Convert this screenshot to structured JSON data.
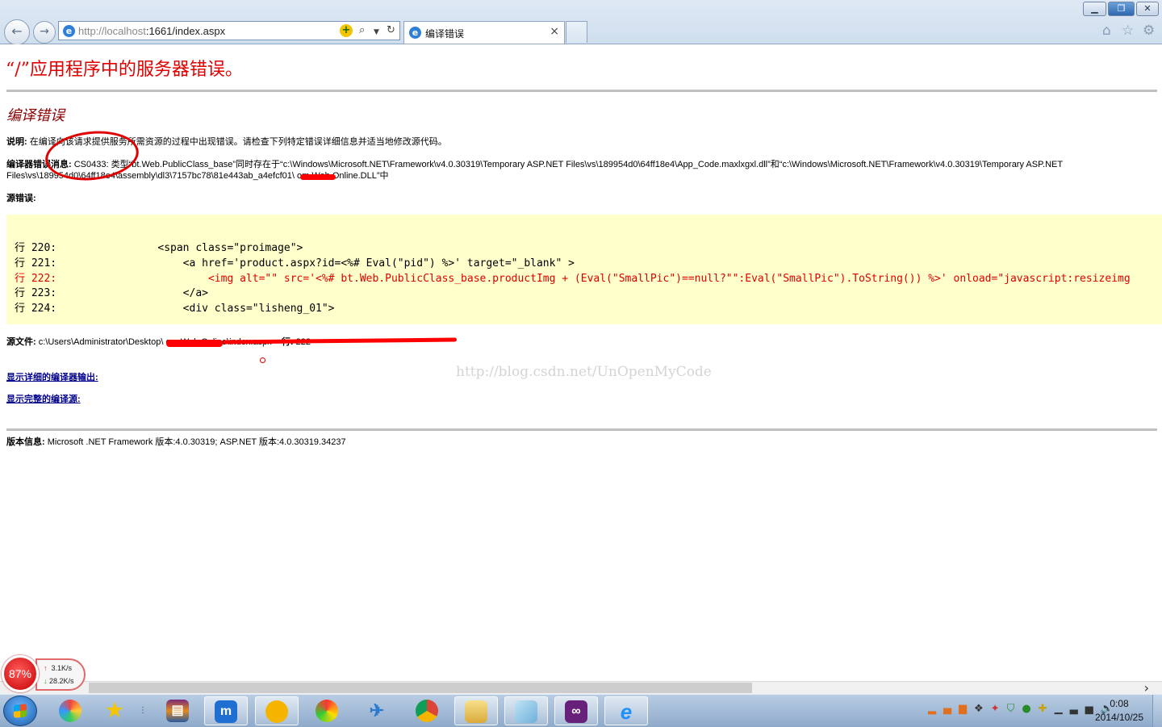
{
  "browser": {
    "address_url_host": "http://localhost",
    "address_url_path": ":1661/index.aspx",
    "tab_title": "编译错误",
    "back_icon": "back-arrow-icon",
    "forward_icon": "forward-arrow-icon"
  },
  "page": {
    "error_title": "“/”应用程序中的服务器错误。",
    "subtitle": "编译错误",
    "description_label": "说明:",
    "description_text": " 在编译向该请求提供服务所需资源的过程中出现错误。请检查下列特定错误详细信息并适当地修改源代码。",
    "compiler_label": "编译器错误消息:",
    "compiler_text": " CS0433: 类型“bt.Web.PublicClass_base”同时存在于“c:\\Windows\\Microsoft.NET\\Framework\\v4.0.30319\\Temporary ASP.NET Files\\vs\\189954d0\\64ff18e4\\App_Code.maxlxgxl.dll”和“c:\\Windows\\Microsoft.NET\\Framework\\v4.0.30319\\Temporary ASP.NET Files\\vs\\189954d0\\64ff18e4\\assembly\\dl3\\7157bc78\\81e443ab_a4efcf01\\         om.Web.Online.DLL”中",
    "source_error_label": "源错误:",
    "code_lines": [
      {
        "prefix": "行 220:",
        "code": "                <span class=\"proimage\">"
      },
      {
        "prefix": "行 221:",
        "code": "                    <a href='product.aspx?id=<%# Eval(\"pid\") %>' target=\"_blank\" >"
      },
      {
        "prefix": "行 222:",
        "code": "                        <img alt=\"\" src='<%# bt.Web.PublicClass_base.productImg + (Eval(\"SmallPic\")==null?\"\":Eval(\"SmallPic\").ToString()) %>' onload=\"javascript:resizeimg"
      },
      {
        "prefix": "行 223:",
        "code": "                    </a>"
      },
      {
        "prefix": "行 224:",
        "code": "                    <div class=\"lisheng_01\">"
      }
    ],
    "source_file_label": "源文件:",
    "source_file_path": " c:\\Users\\Administrator\\Desktop\\                                                                                                  om.Web.Online\\index.aspx",
    "line_label": "行:",
    "line_value": " 222",
    "link_compiler_output": "显示详细的编译器输出:",
    "link_full_source": "显示完整的编译源:",
    "version_label": "版本信息:",
    "version_text": " Microsoft .NET Framework 版本:4.0.30319; ASP.NET 版本:4.0.30319.34237",
    "watermark": "http://blog.csdn.net/UnOpenMyCode"
  },
  "net_monitor": {
    "percent": "87%",
    "upload": "3.1K/s",
    "download": "28.2K/s"
  },
  "taskbar": {
    "clock_time": "0:08",
    "clock_date": "2014/10/25"
  },
  "colors": {
    "error_red": "#e00000",
    "subtitle": "#8b0000",
    "code_bg": "#ffffcc",
    "link": "#00008b"
  }
}
